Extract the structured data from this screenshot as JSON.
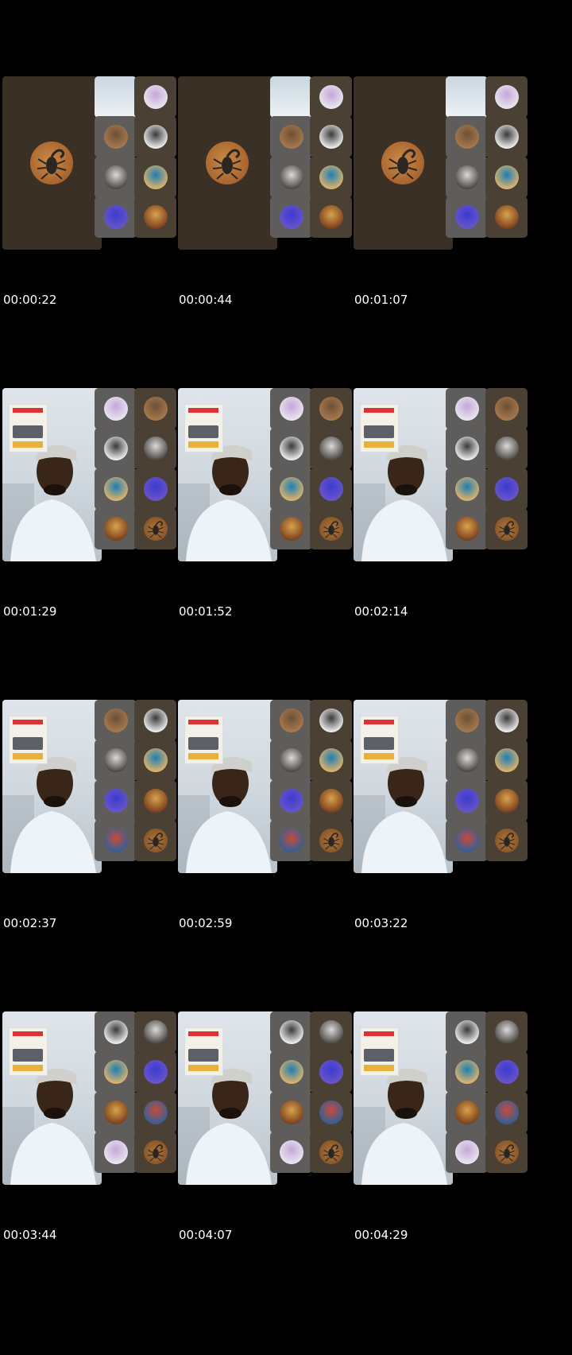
{
  "timestamps": [
    "00:00:22",
    "00:00:44",
    "00:01:07",
    "00:01:29",
    "00:01:52",
    "00:02:14",
    "00:02:37",
    "00:02:59",
    "00:03:22",
    "00:03:44",
    "00:04:07",
    "00:04:29"
  ],
  "colors": {
    "background": "#000000",
    "tile_dark": "#3b3026",
    "tile_gray": "#5f5d5b",
    "tile_brown": "#4a4034"
  },
  "icons": {
    "main_scorpion": "scorpion-avatar-icon",
    "main_person": "speaker-video-feed",
    "tile_avatar": "participant-avatar-icon"
  }
}
